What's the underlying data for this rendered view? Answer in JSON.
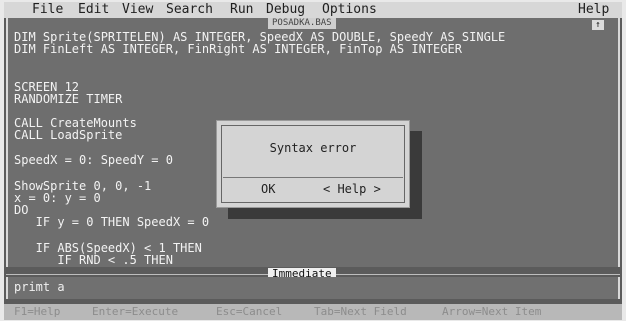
{
  "menu": {
    "file": "File",
    "edit": "Edit",
    "view": "View",
    "search": "Search",
    "run": "Run",
    "debug": "Debug",
    "options": "Options",
    "help": "Help"
  },
  "editor": {
    "title": "POSADKA.BAS",
    "scroll_glyph": "↑",
    "lines": [
      "DIM Sprite(SPRITELEN) AS INTEGER, SpeedX AS DOUBLE, SpeedY AS SINGLE",
      "DIM FinLeft AS INTEGER, FinRight AS INTEGER, FinTop AS INTEGER",
      "SCREEN 12",
      "RANDOMIZE TIMER",
      "CALL CreateMounts",
      "CALL LoadSprite",
      "SpeedX = 0: SpeedY = 0",
      "ShowSprite 0, 0, -1",
      "x = 0: y = 0",
      "DO",
      "   IF y = 0 THEN SpeedX = 0",
      "   IF ABS(SpeedX) < 1 THEN",
      "      IF RND < .5 THEN"
    ]
  },
  "dialog": {
    "message": "Syntax error",
    "ok_label": "OK",
    "help_label": "< Help >"
  },
  "immediate": {
    "title": "Immediate",
    "text": "primt a"
  },
  "status": {
    "help": "F1=Help",
    "execute": "Enter=Execute",
    "cancel": "Esc=Cancel",
    "next_field": "Tab=Next Field",
    "next_item": "Arrow=Next Item"
  }
}
